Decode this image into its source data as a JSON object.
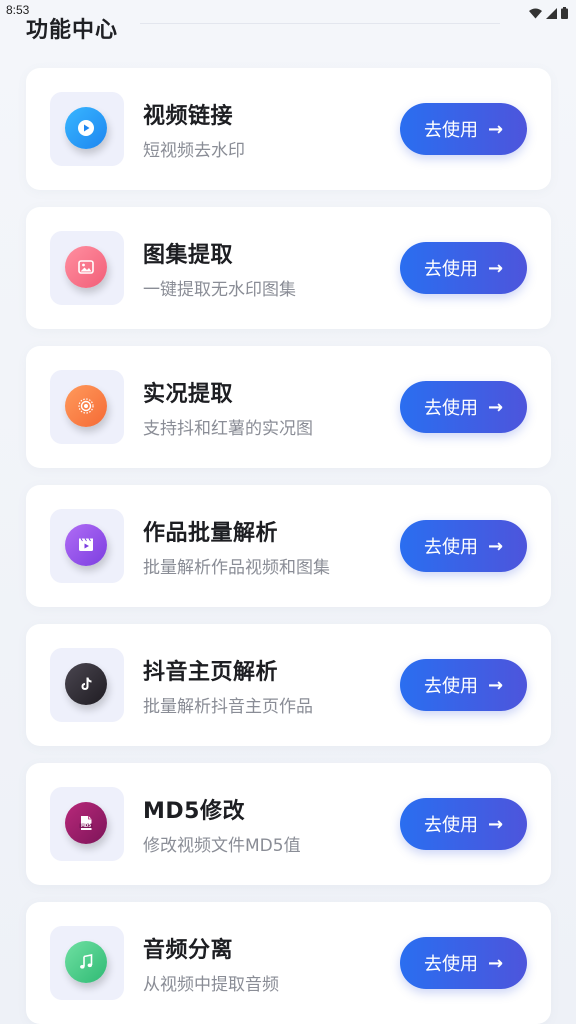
{
  "status_bar": {
    "time": "8:53",
    "icons": [
      "wifi-icon",
      "signal-icon",
      "battery-icon"
    ]
  },
  "header": {
    "title": "功能中心"
  },
  "cards": [
    {
      "name": "video-link",
      "title": "视频链接",
      "subtitle": "短视频去水印",
      "button": "去使用",
      "arrow": "→",
      "icon": "play-icon",
      "color_from": "#38b6ff",
      "color_to": "#1e86f0"
    },
    {
      "name": "gallery-extract",
      "title": "图集提取",
      "subtitle": "一键提取无水印图集",
      "button": "去使用",
      "arrow": "→",
      "icon": "image-icon",
      "color_from": "#ff8fa0",
      "color_to": "#f25e78"
    },
    {
      "name": "live-extract",
      "title": "实况提取",
      "subtitle": "支持抖和红薯的实况图",
      "button": "去使用",
      "arrow": "→",
      "icon": "live-photo-icon",
      "color_from": "#ff9a5c",
      "color_to": "#f56a35"
    },
    {
      "name": "batch-parse",
      "title": "作品批量解析",
      "subtitle": "批量解析作品视频和图集",
      "button": "去使用",
      "arrow": "→",
      "icon": "film-icon",
      "color_from": "#b06cf5",
      "color_to": "#7c3ee0"
    },
    {
      "name": "douyin-home-parse",
      "title": "抖音主页解析",
      "subtitle": "批量解析抖音主页作品",
      "button": "去使用",
      "arrow": "→",
      "icon": "tiktok-icon",
      "color_from": "#4a4650",
      "color_to": "#1f1c22"
    },
    {
      "name": "md5-modify",
      "title": "MD5修改",
      "subtitle": "修改视频文件MD5值",
      "button": "去使用",
      "arrow": "→",
      "icon": "md5-file-icon",
      "color_from": "#b8287a",
      "color_to": "#7d1559"
    },
    {
      "name": "audio-separate",
      "title": "音频分离",
      "subtitle": "从视频中提取音频",
      "button": "去使用",
      "arrow": "→",
      "icon": "music-note-icon",
      "color_from": "#6fe0a2",
      "color_to": "#2fba74"
    }
  ]
}
